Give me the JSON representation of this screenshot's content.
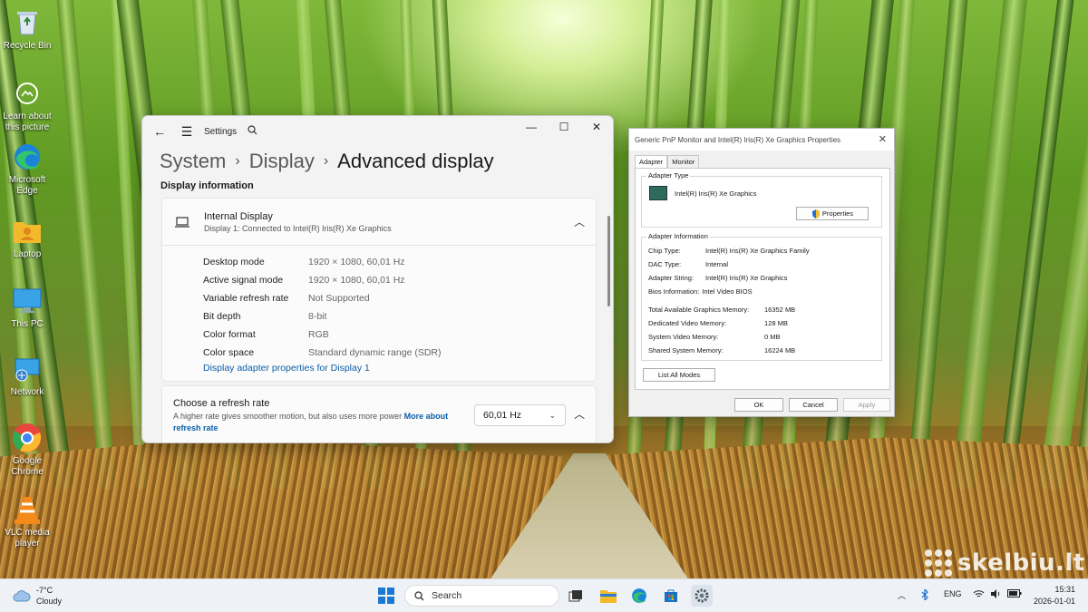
{
  "desktop": {
    "icons": [
      {
        "label": "Recycle Bin"
      },
      {
        "label": "Learn about this picture"
      },
      {
        "label": "Microsoft Edge"
      },
      {
        "label": "Laptop"
      },
      {
        "label": "This PC"
      },
      {
        "label": "Network"
      },
      {
        "label": "Google Chrome"
      },
      {
        "label": "VLC media player"
      }
    ],
    "watermark": "skelbiu.lt"
  },
  "settings": {
    "app_name": "Settings",
    "breadcrumb": {
      "level1": "System",
      "level2": "Display",
      "current": "Advanced display"
    },
    "section_label": "Display information",
    "display": {
      "title": "Internal Display",
      "subtitle": "Display 1: Connected to Intel(R) Iris(R) Xe Graphics",
      "rows": [
        {
          "key": "Desktop mode",
          "value": "1920 × 1080, 60,01 Hz"
        },
        {
          "key": "Active signal mode",
          "value": "1920 × 1080, 60,01 Hz"
        },
        {
          "key": "Variable refresh rate",
          "value": "Not Supported"
        },
        {
          "key": "Bit depth",
          "value": "8-bit"
        },
        {
          "key": "Color format",
          "value": "RGB"
        },
        {
          "key": "Color space",
          "value": "Standard dynamic range (SDR)"
        }
      ],
      "link": "Display adapter properties for Display 1"
    },
    "refresh": {
      "title": "Choose a refresh rate",
      "description": "A higher rate gives smoother motion, but also uses more power",
      "link": "More about refresh rate",
      "selected": "60,01 Hz"
    }
  },
  "properties": {
    "title": "Generic PnP Monitor and Intel(R) Iris(R) Xe Graphics Properties",
    "tabs": [
      "Adapter",
      "Monitor"
    ],
    "adapter_type_label": "Adapter Type",
    "adapter_name": "Intel(R) Iris(R) Xe Graphics",
    "properties_button": "Properties",
    "adapter_info_label": "Adapter Information",
    "info": [
      {
        "key": "Chip Type:",
        "value": "Intel(R) Iris(R) Xe Graphics Family"
      },
      {
        "key": "DAC Type:",
        "value": "Internal"
      },
      {
        "key": "Adapter String:",
        "value": "Intel(R) Iris(R) Xe Graphics"
      },
      {
        "key": "Bios Information:",
        "value": "Intel Video BIOS"
      }
    ],
    "memory": [
      {
        "key": "Total Available Graphics Memory:",
        "value": "16352 MB"
      },
      {
        "key": "Dedicated Video Memory:",
        "value": "128 MB"
      },
      {
        "key": "System Video Memory:",
        "value": "0 MB"
      },
      {
        "key": "Shared System Memory:",
        "value": "16224 MB"
      }
    ],
    "list_modes_button": "List All Modes",
    "ok": "OK",
    "cancel": "Cancel",
    "apply": "Apply"
  },
  "taskbar": {
    "weather_temp": "-7°C",
    "weather_desc": "Cloudy",
    "search_placeholder": "Search",
    "language": "ENG",
    "time": "15:31",
    "date": "2026-01-01"
  }
}
